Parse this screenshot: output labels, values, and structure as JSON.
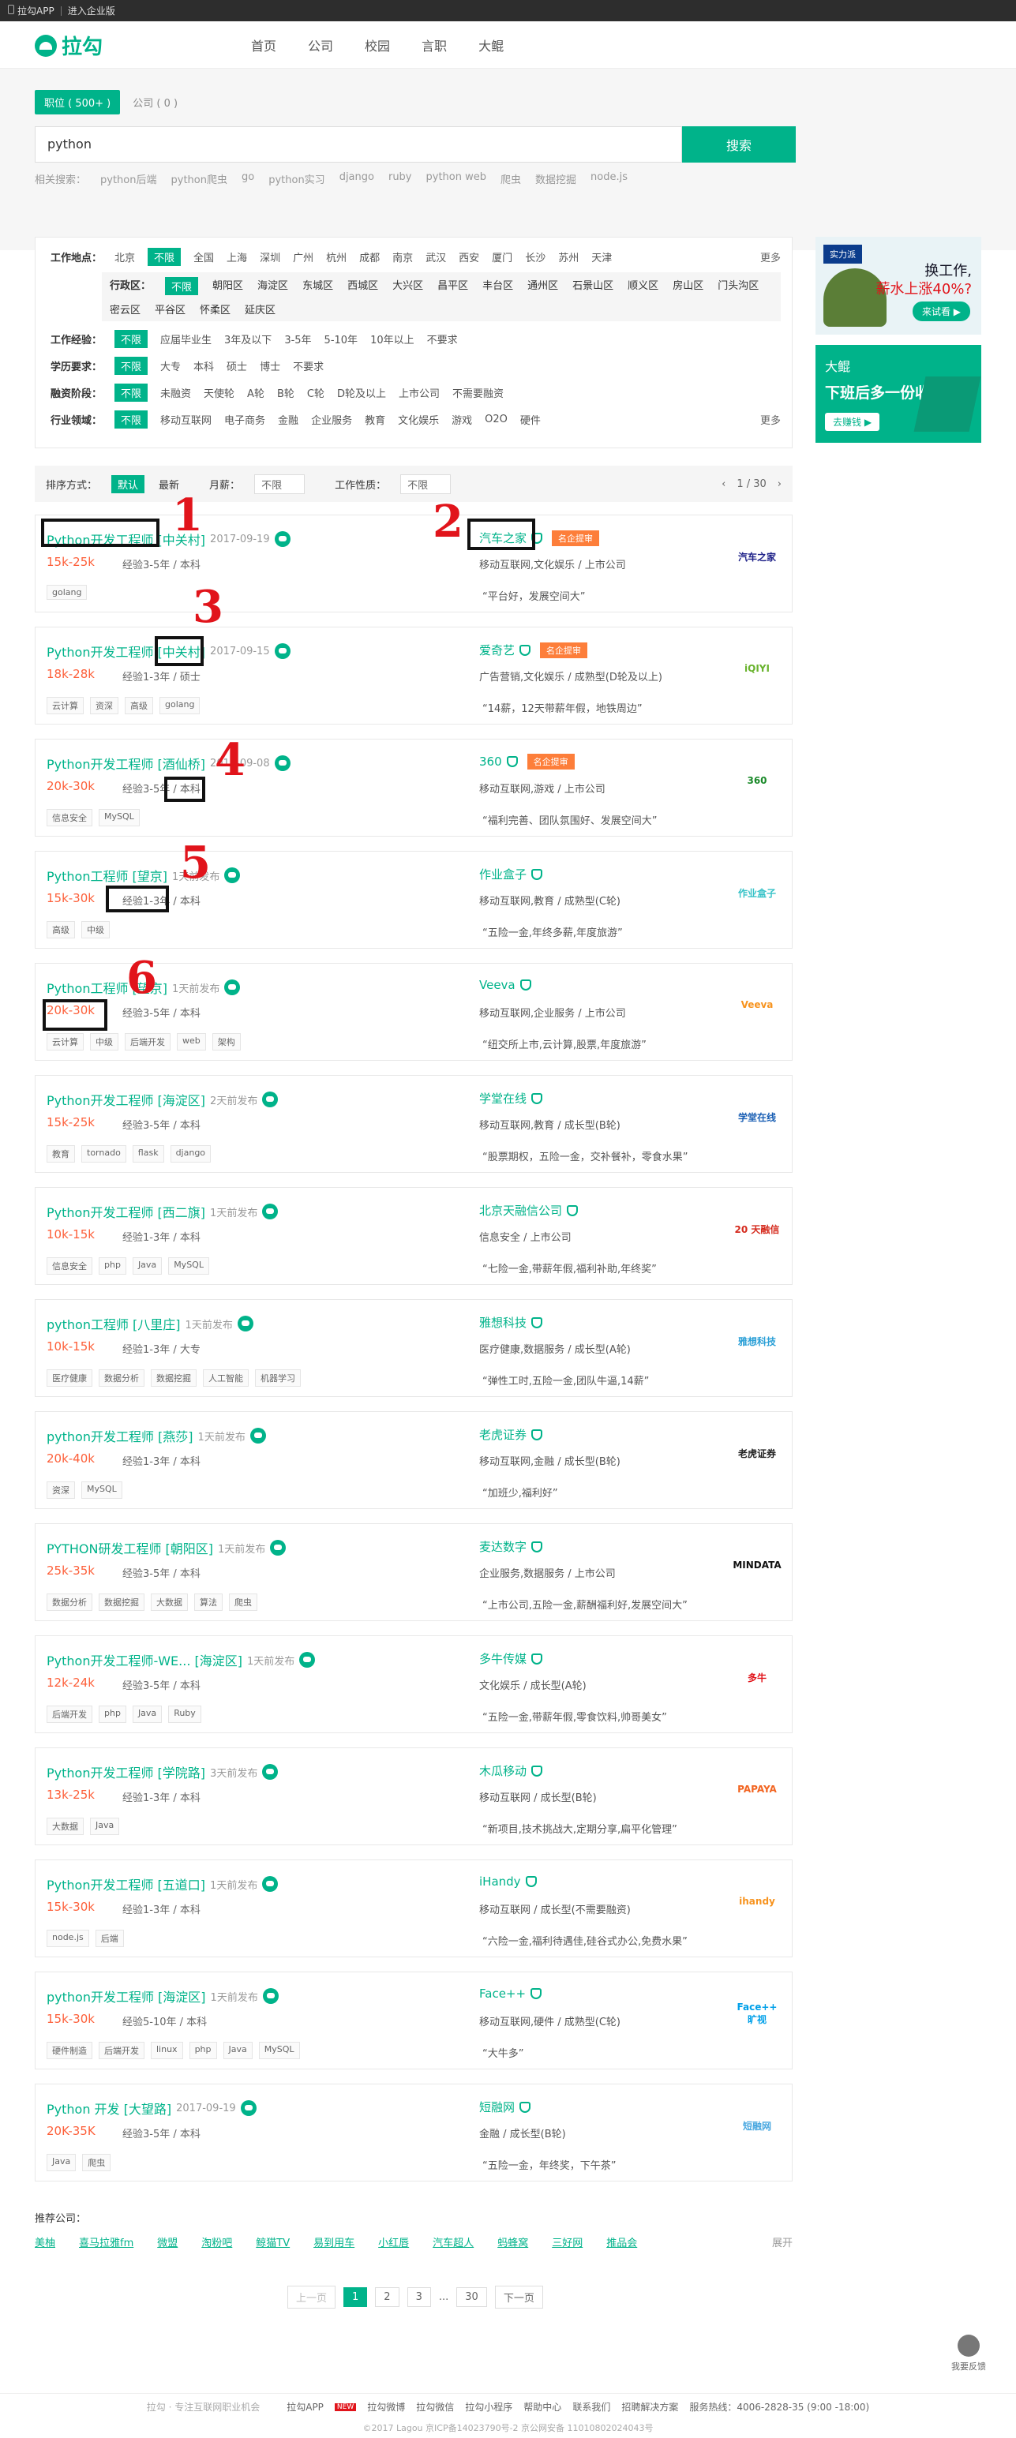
{
  "topbar": {
    "app": "拉勾APP",
    "enterprise": "进入企业版"
  },
  "logo": {
    "text": "拉勾"
  },
  "nav": [
    "首页",
    "公司",
    "校园",
    "言职",
    "大鲲"
  ],
  "search": {
    "tab_positions": "职位 ( 500+ )",
    "tab_companies": "公司 ( 0 )",
    "value": "python",
    "button": "搜索",
    "related_label": "相关搜索：",
    "related": [
      "python后端",
      "python爬虫",
      "go",
      "python实习",
      "django",
      "ruby",
      "python web",
      "爬虫",
      "数据挖掘",
      "node.js"
    ]
  },
  "filters": {
    "location": {
      "label": "工作地点：",
      "current": "北京",
      "options": [
        "不限",
        "全国",
        "上海",
        "深圳",
        "广州",
        "杭州",
        "成都",
        "南京",
        "武汉",
        "西安",
        "厦门",
        "长沙",
        "苏州",
        "天津"
      ],
      "more": "更多"
    },
    "district": {
      "label": "行政区：",
      "options": [
        "不限",
        "朝阳区",
        "海淀区",
        "东城区",
        "西城区",
        "大兴区",
        "昌平区",
        "丰台区",
        "通州区",
        "石景山区",
        "顺义区",
        "房山区",
        "门头沟区",
        "密云区",
        "平谷区",
        "怀柔区",
        "延庆区"
      ]
    },
    "experience": {
      "label": "工作经验：",
      "options": [
        "不限",
        "应届毕业生",
        "3年及以下",
        "3-5年",
        "5-10年",
        "10年以上",
        "不要求"
      ]
    },
    "education": {
      "label": "学历要求：",
      "options": [
        "不限",
        "大专",
        "本科",
        "硕士",
        "博士",
        "不要求"
      ]
    },
    "financing": {
      "label": "融资阶段：",
      "options": [
        "不限",
        "未融资",
        "天使轮",
        "A轮",
        "B轮",
        "C轮",
        "D轮及以上",
        "上市公司",
        "不需要融资"
      ]
    },
    "industry": {
      "label": "行业领域：",
      "options": [
        "不限",
        "移动互联网",
        "电子商务",
        "金融",
        "企业服务",
        "教育",
        "文化娱乐",
        "游戏",
        "O2O",
        "硬件"
      ],
      "more": "更多"
    }
  },
  "sortbar": {
    "label": "排序方式：",
    "default": "默认",
    "latest": "最新",
    "salary_label": "月薪：",
    "salary_value": "不限",
    "nature_label": "工作性质：",
    "nature_value": "不限",
    "page": "1 / 30"
  },
  "jobs": [
    {
      "title": "Python开发工程师 [中关村]",
      "time": "2017-09-19",
      "salary": "15k-25k",
      "req": "经验3-5年 / 本科",
      "tags": [
        "golang"
      ],
      "company": "汽车之家",
      "famous": "名企提审",
      "industry": "移动互联网,文化娱乐 / 上市公司",
      "slogan": "“平台好，发展空间大”",
      "logo": "汽车之家",
      "logo_color": "#1d2088"
    },
    {
      "title": "Python开发工程师 [中关村]",
      "time": "2017-09-15",
      "salary": "18k-28k",
      "req": "经验1-3年 / 硕士",
      "tags": [
        "云计算",
        "资深",
        "高级",
        "golang"
      ],
      "company": "爱奇艺",
      "famous": "名企提审",
      "industry": "广告营销,文化娱乐 / 成熟型(D轮及以上)",
      "slogan": "“14薪，12天带薪年假，地铁周边”",
      "logo": "iQIYI",
      "logo_color": "#69b32d"
    },
    {
      "title": "Python开发工程师 [酒仙桥]",
      "time": "2017-09-08",
      "salary": "20k-30k",
      "req": "经验3-5年 / 本科",
      "tags": [
        "信息安全",
        "MySQL"
      ],
      "company": "360",
      "famous": "名企提审",
      "industry": "移动互联网,游戏 / 上市公司",
      "slogan": "“福利完善、团队氛围好、发展空间大”",
      "logo": "360",
      "logo_color": "#1b8a2a"
    },
    {
      "title": "Python工程师 [望京]",
      "time": "1天前发布",
      "salary": "15k-30k",
      "req": "经验1-3年 / 本科",
      "tags": [
        "高级",
        "中级"
      ],
      "company": "作业盒子",
      "famous": "",
      "industry": "移动互联网,教育 / 成熟型(C轮)",
      "slogan": "“五险一金,年终多薪,年度旅游”",
      "logo": "作业盒子",
      "logo_color": "#36c2c7"
    },
    {
      "title": "Python工程师 [望京]",
      "time": "1天前发布",
      "salary": "20k-30k",
      "req": "经验3-5年 / 本科",
      "tags": [
        "云计算",
        "中级",
        "后端开发",
        "web",
        "架构"
      ],
      "company": "Veeva",
      "famous": "",
      "industry": "移动互联网,企业服务 / 上市公司",
      "slogan": "“纽交所上市,云计算,股票,年度旅游”",
      "logo": "Veeva",
      "logo_color": "#f7931e"
    },
    {
      "title": "Python开发工程师 [海淀区]",
      "time": "2天前发布",
      "salary": "15k-25k",
      "req": "经验3-5年 / 本科",
      "tags": [
        "教育",
        "tornado",
        "flask",
        "django"
      ],
      "company": "学堂在线",
      "famous": "",
      "industry": "移动互联网,教育 / 成长型(B轮)",
      "slogan": "“股票期权，五险一金，交补餐补，零食水果”",
      "logo": "学堂在线",
      "logo_color": "#1a5fb4"
    },
    {
      "title": "Python开发工程师 [西二旗]",
      "time": "1天前发布",
      "salary": "10k-15k",
      "req": "经验1-3年 / 本科",
      "tags": [
        "信息安全",
        "php",
        "Java",
        "MySQL"
      ],
      "company": "北京天融信公司",
      "famous": "",
      "industry": "信息安全 / 上市公司",
      "slogan": "“七险一金,带薪年假,福利补助,年终奖”",
      "logo": "20 天融信",
      "logo_color": "#d52b1e"
    },
    {
      "title": "python工程师 [八里庄]",
      "time": "1天前发布",
      "salary": "10k-15k",
      "req": "经验1-3年 / 大专",
      "tags": [
        "医疗健康",
        "数据分析",
        "数据挖掘",
        "人工智能",
        "机器学习"
      ],
      "company": "雅想科技",
      "famous": "",
      "industry": "医疗健康,数据服务 / 成长型(A轮)",
      "slogan": "“弹性工时,五险一金,团队牛逼,14薪”",
      "logo": "雅想科技",
      "logo_color": "#2a9fd6"
    },
    {
      "title": "python开发工程师 [燕莎]",
      "time": "1天前发布",
      "salary": "20k-40k",
      "req": "经验1-3年 / 本科",
      "tags": [
        "资深",
        "MySQL"
      ],
      "company": "老虎证券",
      "famous": "",
      "industry": "移动互联网,金融 / 成长型(B轮)",
      "slogan": "“加班少,福利好”",
      "logo": "老虎证券",
      "logo_color": "#222222"
    },
    {
      "title": "PYTHON研发工程师 [朝阳区]",
      "time": "1天前发布",
      "salary": "25k-35k",
      "req": "经验3-5年 / 本科",
      "tags": [
        "数据分析",
        "数据挖掘",
        "大数据",
        "算法",
        "爬虫"
      ],
      "company": "麦达数字",
      "famous": "",
      "industry": "企业服务,数据服务 / 上市公司",
      "slogan": "“上市公司,五险一金,薪酬福利好,发展空间大”",
      "logo": "MINDATA",
      "logo_color": "#111111"
    },
    {
      "title": "Python开发工程师-WE... [海淀区]",
      "time": "1天前发布",
      "salary": "12k-24k",
      "req": "经验3-5年 / 本科",
      "tags": [
        "后端开发",
        "php",
        "Java",
        "Ruby"
      ],
      "company": "多牛传媒",
      "famous": "",
      "industry": "文化娱乐 / 成长型(A轮)",
      "slogan": "“五险一金,带薪年假,零食饮料,帅哥美女”",
      "logo": "多牛",
      "logo_color": "#e1141b"
    },
    {
      "title": "Python开发工程师 [学院路]",
      "time": "3天前发布",
      "salary": "13k-25k",
      "req": "经验1-3年 / 本科",
      "tags": [
        "大数据",
        "Java"
      ],
      "company": "木瓜移动",
      "famous": "",
      "industry": "移动互联网 / 成长型(B轮)",
      "slogan": "“新项目,技术挑战大,定期分享,扁平化管理”",
      "logo": "PAPAYA",
      "logo_color": "#f26522"
    },
    {
      "title": "Python开发工程师 [五道口]",
      "time": "1天前发布",
      "salary": "15k-30k",
      "req": "经验1-3年 / 本科",
      "tags": [
        "node.js",
        "后端"
      ],
      "company": "iHandy",
      "famous": "",
      "industry": "移动互联网 / 成长型(不需要融资)",
      "slogan": "“六险一金,福利待遇佳,硅谷式办公,免费水果”",
      "logo": "ihandy",
      "logo_color": "#f7931e"
    },
    {
      "title": "python开发工程师 [海淀区]",
      "time": "1天前发布",
      "salary": "15k-30k",
      "req": "经验5-10年 / 本科",
      "tags": [
        "硬件制造",
        "后端开发",
        "linux",
        "php",
        "Java",
        "MySQL"
      ],
      "company": "Face++",
      "famous": "",
      "industry": "移动互联网,硬件 / 成熟型(C轮)",
      "slogan": "“大牛多”",
      "logo": "Face++ 旷视",
      "logo_color": "#00a0e9"
    },
    {
      "title": "Python 开发 [大望路]",
      "time": "2017-09-19",
      "salary": "20K-35K",
      "req": "经验3-5年 / 本科",
      "tags": [
        "Java",
        "爬虫"
      ],
      "company": "短融网",
      "famous": "",
      "industry": "金融 / 成长型(B轮)",
      "slogan": "“五险一金，年终奖，下午茶”",
      "logo": "短融网",
      "logo_color": "#4aa8e0"
    }
  ],
  "ads": {
    "ad1": {
      "brand": "实力派",
      "line1": "换工作,",
      "line2": "薪水上涨40%?",
      "button": "来试看 ▶"
    },
    "ad2": {
      "brand": "大鲲",
      "line1": "下班后多一份收入",
      "button": "去赚钱 ▶"
    }
  },
  "recommend": {
    "title": "推荐公司：",
    "companies": [
      "美柚",
      "喜马拉雅fm",
      "微盟",
      "淘粉吧",
      "鲸猫TV",
      "易到用车",
      "小红唇",
      "汽车超人",
      "蚂蜂窝",
      "三好网",
      "推品会"
    ],
    "expand": "展开"
  },
  "pagination": {
    "prev": "上一页",
    "pages": [
      "1",
      "2",
      "3",
      "...",
      "30"
    ],
    "next": "下一页"
  },
  "footer": {
    "slogan": "拉勾 · 专注互联网职业机会",
    "links": [
      "拉勾APP",
      "拉勾微博",
      "拉勾微信",
      "拉勾小程序",
      "帮助中心",
      "联系我们",
      "招聘解决方案",
      "服务热线：4006-2828-35 (9:00 -18:00)"
    ],
    "new": "NEW",
    "copyright": "©2017 Lagou 京ICP备14023790号-2 京公网安备 11010802024043号"
  },
  "feedback": "我要反馈",
  "annotations": [
    "1",
    "2",
    "3",
    "4",
    "5",
    "6"
  ]
}
